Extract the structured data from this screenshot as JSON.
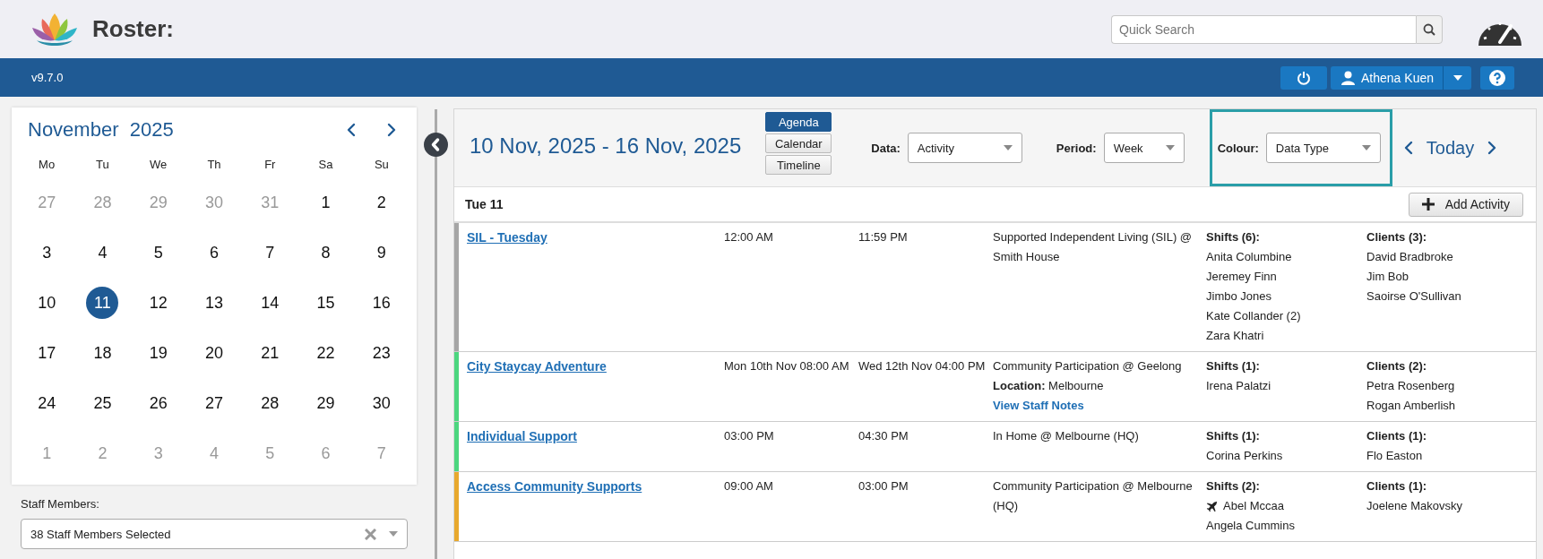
{
  "app": {
    "title": "Roster:",
    "search": {
      "placeholder": "Quick Search"
    },
    "version": "v9.7.0",
    "user": "Athena Kuen"
  },
  "calendar": {
    "month": "November",
    "year": "2025",
    "weekdays": [
      "Mo",
      "Tu",
      "We",
      "Th",
      "Fr",
      "Sa",
      "Su"
    ],
    "weeks": [
      [
        {
          "day": "27",
          "outside": true,
          "selected": false
        },
        {
          "day": "28",
          "outside": true,
          "selected": false
        },
        {
          "day": "29",
          "outside": true,
          "selected": false
        },
        {
          "day": "30",
          "outside": true,
          "selected": false
        },
        {
          "day": "31",
          "outside": true,
          "selected": false
        },
        {
          "day": "1",
          "outside": false,
          "selected": false
        },
        {
          "day": "2",
          "outside": false,
          "selected": false
        }
      ],
      [
        {
          "day": "3",
          "outside": false,
          "selected": false
        },
        {
          "day": "4",
          "outside": false,
          "selected": false
        },
        {
          "day": "5",
          "outside": false,
          "selected": false
        },
        {
          "day": "6",
          "outside": false,
          "selected": false
        },
        {
          "day": "7",
          "outside": false,
          "selected": false
        },
        {
          "day": "8",
          "outside": false,
          "selected": false
        },
        {
          "day": "9",
          "outside": false,
          "selected": false
        }
      ],
      [
        {
          "day": "10",
          "outside": false,
          "selected": false
        },
        {
          "day": "11",
          "outside": false,
          "selected": true
        },
        {
          "day": "12",
          "outside": false,
          "selected": false
        },
        {
          "day": "13",
          "outside": false,
          "selected": false
        },
        {
          "day": "14",
          "outside": false,
          "selected": false
        },
        {
          "day": "15",
          "outside": false,
          "selected": false
        },
        {
          "day": "16",
          "outside": false,
          "selected": false
        }
      ],
      [
        {
          "day": "17",
          "outside": false,
          "selected": false
        },
        {
          "day": "18",
          "outside": false,
          "selected": false
        },
        {
          "day": "19",
          "outside": false,
          "selected": false
        },
        {
          "day": "20",
          "outside": false,
          "selected": false
        },
        {
          "day": "21",
          "outside": false,
          "selected": false
        },
        {
          "day": "22",
          "outside": false,
          "selected": false
        },
        {
          "day": "23",
          "outside": false,
          "selected": false
        }
      ],
      [
        {
          "day": "24",
          "outside": false,
          "selected": false
        },
        {
          "day": "25",
          "outside": false,
          "selected": false
        },
        {
          "day": "26",
          "outside": false,
          "selected": false
        },
        {
          "day": "27",
          "outside": false,
          "selected": false
        },
        {
          "day": "28",
          "outside": false,
          "selected": false
        },
        {
          "day": "29",
          "outside": false,
          "selected": false
        },
        {
          "day": "30",
          "outside": false,
          "selected": false
        }
      ],
      [
        {
          "day": "1",
          "outside": true,
          "selected": false
        },
        {
          "day": "2",
          "outside": true,
          "selected": false
        },
        {
          "day": "3",
          "outside": true,
          "selected": false
        },
        {
          "day": "4",
          "outside": true,
          "selected": false
        },
        {
          "day": "5",
          "outside": true,
          "selected": false
        },
        {
          "day": "6",
          "outside": true,
          "selected": false
        },
        {
          "day": "7",
          "outside": true,
          "selected": false
        }
      ]
    ]
  },
  "staff_filter": {
    "label": "Staff Members:",
    "value": "38 Staff Members Selected"
  },
  "agenda": {
    "date_range": "10 Nov, 2025 - 16 Nov, 2025",
    "views": [
      {
        "label": "Agenda",
        "selected": true
      },
      {
        "label": "Calendar",
        "selected": false
      },
      {
        "label": "Timeline",
        "selected": false
      }
    ],
    "filters": [
      {
        "label": "Data:",
        "value": "Activity",
        "highlighted": false
      },
      {
        "label": "Period:",
        "value": "Week",
        "highlighted": false
      },
      {
        "label": "Colour:",
        "value": "Data Type",
        "highlighted": true
      }
    ],
    "today": "Today",
    "day_label": "Tue 11",
    "add_button": "Add Activity",
    "activities": [
      {
        "title": "SIL - Tuesday",
        "color": "#a6a6a6",
        "start": "12:00 AM",
        "end": "11:59 PM",
        "location": "Supported Independent Living (SIL) @ Smith House",
        "shifts_label": "Shifts (6):",
        "shifts": [
          {
            "name": "Anita Columbine",
            "kind": "plain"
          },
          {
            "name": "Jeremey Finn",
            "kind": "plain"
          },
          {
            "name": "Jimbo Jones",
            "kind": "plain"
          },
          {
            "name": "Kate Collander (2)",
            "kind": "plain"
          },
          {
            "name": "Zara Khatri",
            "kind": "plain"
          }
        ],
        "clients_label": "Clients (3):",
        "clients": [
          "David Bradbroke",
          "Jim Bob",
          "Saoirse O'Sullivan"
        ]
      },
      {
        "title": "City Staycay Adventure",
        "color": "#4cd67f",
        "start": "Mon 10th Nov 08:00 AM",
        "end": "Wed 12th Nov 04:00 PM",
        "location": "Community Participation @ Geelong",
        "location_detail": "**Location:** Melbourne",
        "notes_link": "View Staff Notes",
        "shifts_label": "Shifts (1):",
        "shifts": [
          {
            "name": "Irena Palatzi",
            "kind": "plain"
          }
        ],
        "clients_label": "Clients (2):",
        "clients": [
          "Petra Rosenberg",
          "Rogan Amberlish"
        ]
      },
      {
        "title": "Individual Support",
        "color": "#4cd67f",
        "start": "03:00 PM",
        "end": "04:30 PM",
        "location": "In Home @ Melbourne (HQ)",
        "shifts_label": "Shifts (1):",
        "shifts": [
          {
            "name": "Corina Perkins",
            "kind": "plain"
          }
        ],
        "clients_label": "Clients (1):",
        "clients": [
          "Flo Easton"
        ]
      },
      {
        "title": "Access Community Supports",
        "color": "#e8a92e",
        "start": "09:00 AM",
        "end": "03:00 PM",
        "location": "Community Participation @ Melbourne (HQ)",
        "shifts_label": "Shifts (2):",
        "shifts": [
          {
            "name": "Abel Mccaa",
            "kind": "travel"
          },
          {
            "name": "Angela Cummins",
            "kind": "plain"
          }
        ],
        "clients_label": "Clients (1):",
        "clients": [
          "Joelene Makovsky"
        ]
      }
    ]
  }
}
